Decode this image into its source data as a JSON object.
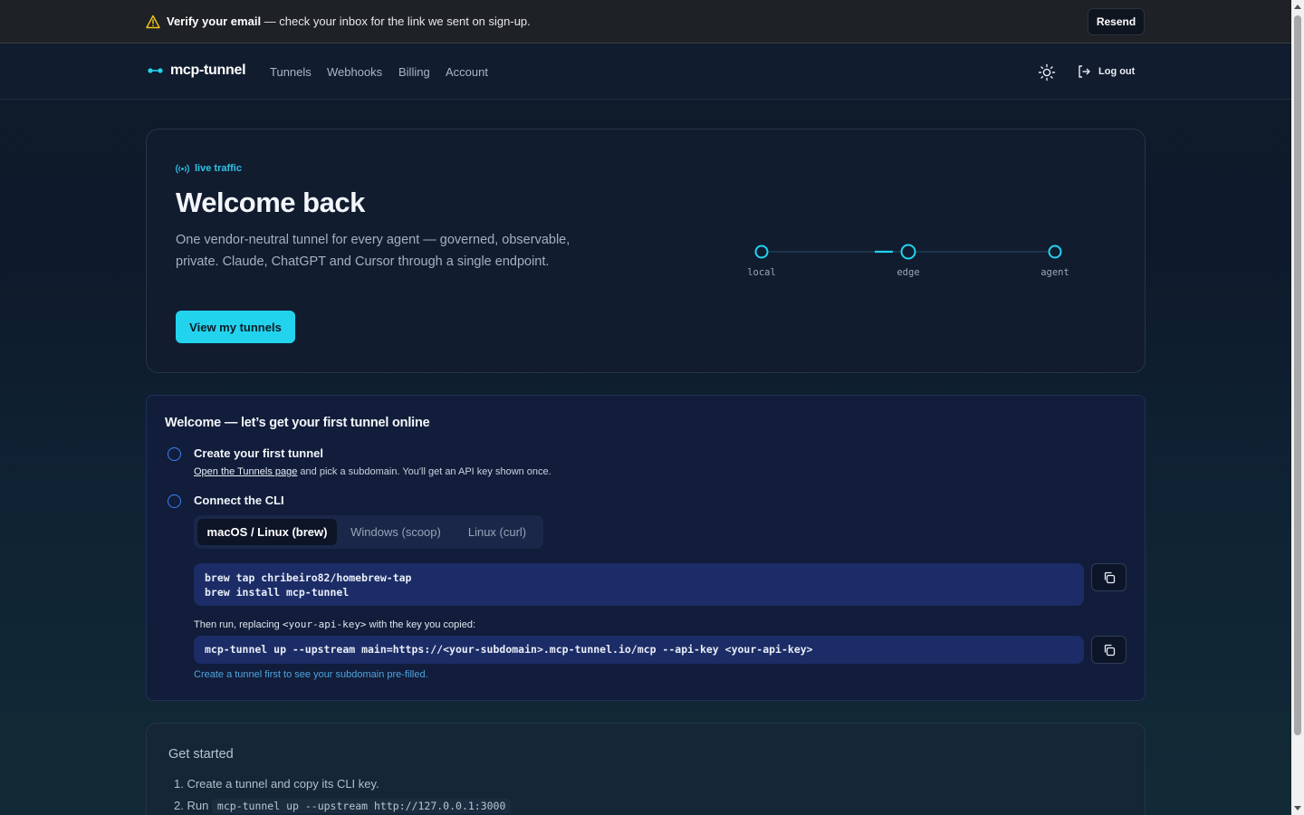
{
  "banner": {
    "title": "Verify your email",
    "message": " — check your inbox for the link we sent on sign-up.",
    "resend_label": "Resend",
    "icon": "warning-icon"
  },
  "nav": {
    "brand": "mcp-tunnel",
    "links": [
      "Tunnels",
      "Webhooks",
      "Billing",
      "Account"
    ],
    "logout_label": "Log out"
  },
  "hero": {
    "badge": "live traffic",
    "title": "Welcome back",
    "description": "One vendor-neutral tunnel for every agent — governed, observable, private. Claude, ChatGPT and Cursor through a single endpoint.",
    "cta_label": "View my tunnels",
    "flow_nodes": [
      "local",
      "edge",
      "agent"
    ]
  },
  "onboarding": {
    "title": "Welcome — let’s get your first tunnel online",
    "step1": {
      "title": "Create your first tunnel",
      "link_text": "Open the Tunnels page",
      "desc_rest": " and pick a subdomain. You'll get an API key shown once."
    },
    "step2": {
      "title": "Connect the CLI",
      "tabs": [
        "macOS / Linux (brew)",
        "Windows (scoop)",
        "Linux (curl)"
      ],
      "active_tab": "macOS / Linux (brew)",
      "code_lines": [
        "brew tap chribeiro82/homebrew-tap",
        "brew install mcp-tunnel"
      ],
      "note_pre": "Then run, replacing ",
      "note_code": "<your-api-key>",
      "note_post": " with the key you copied:",
      "run_command": "mcp-tunnel up --upstream main=https://<your-subdomain>.mcp-tunnel.io/mcp --api-key <your-api-key>",
      "hint": "Create a tunnel first to see your subdomain pre-filled."
    }
  },
  "get_started": {
    "title": "Get started",
    "item1": "1. Create a tunnel and copy its CLI key.",
    "item2_prefix": "2. Run ",
    "item2_code": "mcp-tunnel up --upstream http://127.0.0.1:3000"
  },
  "colors": {
    "accent": "#22d3ee",
    "step_ring": "#3b82f6",
    "warning": "#f5c518"
  }
}
